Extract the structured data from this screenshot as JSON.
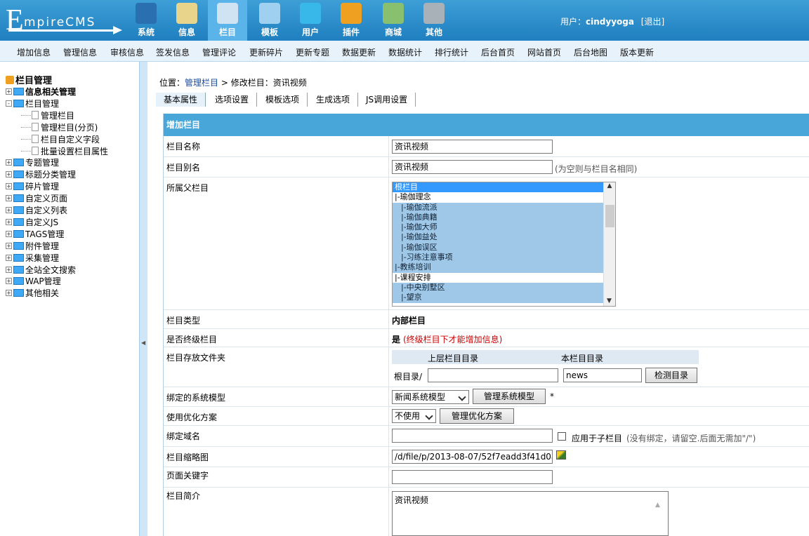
{
  "app": {
    "logo_big": "E",
    "logo_small": "mpireCMS"
  },
  "nav": [
    {
      "label": "系统",
      "icon": "globe-icon",
      "color": "#2a6fb0"
    },
    {
      "label": "信息",
      "icon": "notepad-icon",
      "color": "#e8d48a"
    },
    {
      "label": "栏目",
      "icon": "folder-icon",
      "color": "#cfe3f3"
    },
    {
      "label": "模板",
      "icon": "window-icon",
      "color": "#9fd0ef"
    },
    {
      "label": "用户",
      "icon": "user-icon",
      "color": "#37b8e8"
    },
    {
      "label": "插件",
      "icon": "tools-icon",
      "color": "#f0a020"
    },
    {
      "label": "商城",
      "icon": "card-icon",
      "color": "#88c070"
    },
    {
      "label": "其他",
      "icon": "gear-icon",
      "color": "#a8b0b8"
    }
  ],
  "user": {
    "prefix": "用户：",
    "name": "cindyyoga",
    "logout": "[退出]"
  },
  "menu": [
    "增加信息",
    "管理信息",
    "审核信息",
    "签发信息",
    "管理评论",
    "更新碎片",
    "更新专题",
    "数据更新",
    "数据统计",
    "排行统计",
    "后台首页",
    "网站首页",
    "后台地图",
    "版本更新"
  ],
  "tree": {
    "root": "栏目管理",
    "items": [
      {
        "label": "信息相关管理",
        "bold": true,
        "kind": "folder",
        "pm": "+"
      },
      {
        "label": "栏目管理",
        "kind": "folder-open",
        "pm": "-"
      },
      {
        "label": "管理栏目",
        "kind": "doc"
      },
      {
        "label": "管理栏目(分页)",
        "kind": "doc"
      },
      {
        "label": "栏目自定义字段",
        "kind": "doc"
      },
      {
        "label": "批量设置栏目属性",
        "kind": "doc"
      },
      {
        "label": "专题管理",
        "kind": "folder",
        "pm": "+"
      },
      {
        "label": "标题分类管理",
        "kind": "folder",
        "pm": "+"
      },
      {
        "label": "碎片管理",
        "kind": "folder",
        "pm": "+"
      },
      {
        "label": "自定义页面",
        "kind": "folder",
        "pm": "+"
      },
      {
        "label": "自定义列表",
        "kind": "folder",
        "pm": "+"
      },
      {
        "label": "自定义JS",
        "kind": "folder",
        "pm": "+"
      },
      {
        "label": "TAGS管理",
        "kind": "folder",
        "pm": "+"
      },
      {
        "label": "附件管理",
        "kind": "folder",
        "pm": "+"
      },
      {
        "label": "采集管理",
        "kind": "folder",
        "pm": "+"
      },
      {
        "label": "全站全文搜索",
        "kind": "folder",
        "pm": "+"
      },
      {
        "label": "WAP管理",
        "kind": "folder",
        "pm": "+"
      },
      {
        "label": "其他相关",
        "kind": "folder",
        "pm": "+"
      }
    ]
  },
  "breadcrumb": {
    "prefix": "位置：",
    "link": "管理栏目",
    "rest": " > 修改栏目：资讯视频"
  },
  "tabs": [
    "基本属性",
    "选项设置",
    "模板选项",
    "生成选项",
    "JS调用设置"
  ],
  "form": {
    "title": "增加栏目",
    "name_label": "栏目名称",
    "name_value": "资讯视频",
    "alias_label": "栏目别名",
    "alias_value": "资讯视频",
    "alias_hint": "(为空则与栏目名相同)",
    "parent_label": "所属父栏目",
    "parent_options": [
      "根栏目",
      "|-瑜伽理念",
      "|-瑜伽流派",
      "|-瑜伽典籍",
      "|-瑜伽大师",
      "|-瑜伽益处",
      "|-瑜伽误区",
      "|-习练注意事项",
      "|-教练培训",
      "|-课程安排",
      "|-中央别墅区",
      "|-望京"
    ],
    "type_label": "栏目类型",
    "type_value": "内部栏目",
    "final_label": "是否终级栏目",
    "final_value": "是",
    "final_hint": "(终级栏目下才能增加信息)",
    "folder_label": "栏目存放文件夹",
    "folder_col1": "上层栏目目录",
    "folder_col2": "本栏目目录",
    "folder_root": "根目录/",
    "folder_parent_value": "",
    "folder_value": "news",
    "folder_check": "检测目录",
    "model_label": "绑定的系统模型",
    "model_value": "新闻系统模型",
    "model_btn": "管理系统模型",
    "model_star": "*",
    "opt_label": "使用优化方案",
    "opt_value": "不使用",
    "opt_btn": "管理优化方案",
    "domain_label": "绑定域名",
    "domain_value": "",
    "domain_check_label": "应用于子栏目",
    "domain_hint": "(没有绑定，请留空.后面无需加\"/\")",
    "thumb_label": "栏目缩略图",
    "thumb_value": "/d/file/p/2013-08-07/52f7eadd3f41d0a5ac",
    "kw_label": "页面关键字",
    "kw_value": "",
    "intro_label": "栏目简介",
    "intro_value": "资讯视频"
  }
}
